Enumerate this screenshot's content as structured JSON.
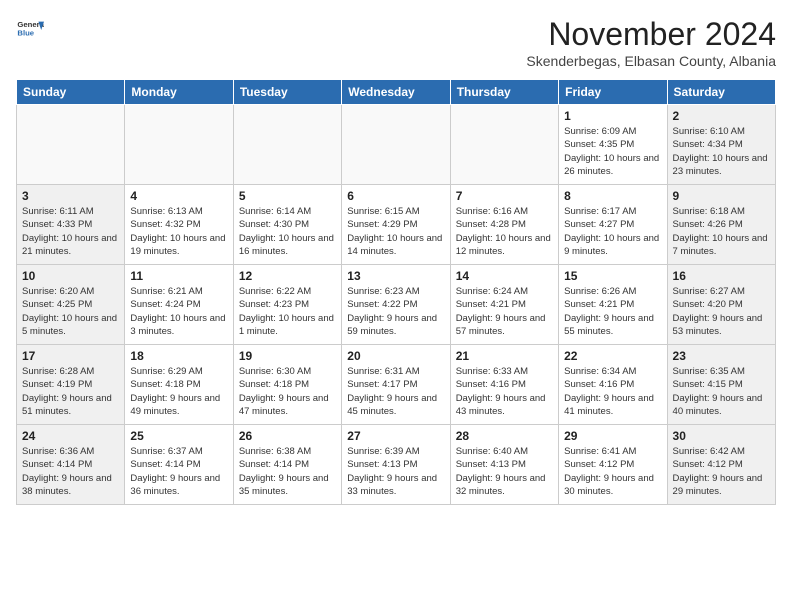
{
  "header": {
    "logo": {
      "general": "General",
      "blue": "Blue"
    },
    "month_year": "November 2024",
    "location": "Skenderbegas, Elbasan County, Albania"
  },
  "days_of_week": [
    "Sunday",
    "Monday",
    "Tuesday",
    "Wednesday",
    "Thursday",
    "Friday",
    "Saturday"
  ],
  "weeks": [
    [
      {
        "day": "",
        "info": ""
      },
      {
        "day": "",
        "info": ""
      },
      {
        "day": "",
        "info": ""
      },
      {
        "day": "",
        "info": ""
      },
      {
        "day": "",
        "info": ""
      },
      {
        "day": "1",
        "info": "Sunrise: 6:09 AM\nSunset: 4:35 PM\nDaylight: 10 hours and 26 minutes."
      },
      {
        "day": "2",
        "info": "Sunrise: 6:10 AM\nSunset: 4:34 PM\nDaylight: 10 hours and 23 minutes."
      }
    ],
    [
      {
        "day": "3",
        "info": "Sunrise: 6:11 AM\nSunset: 4:33 PM\nDaylight: 10 hours and 21 minutes."
      },
      {
        "day": "4",
        "info": "Sunrise: 6:13 AM\nSunset: 4:32 PM\nDaylight: 10 hours and 19 minutes."
      },
      {
        "day": "5",
        "info": "Sunrise: 6:14 AM\nSunset: 4:30 PM\nDaylight: 10 hours and 16 minutes."
      },
      {
        "day": "6",
        "info": "Sunrise: 6:15 AM\nSunset: 4:29 PM\nDaylight: 10 hours and 14 minutes."
      },
      {
        "day": "7",
        "info": "Sunrise: 6:16 AM\nSunset: 4:28 PM\nDaylight: 10 hours and 12 minutes."
      },
      {
        "day": "8",
        "info": "Sunrise: 6:17 AM\nSunset: 4:27 PM\nDaylight: 10 hours and 9 minutes."
      },
      {
        "day": "9",
        "info": "Sunrise: 6:18 AM\nSunset: 4:26 PM\nDaylight: 10 hours and 7 minutes."
      }
    ],
    [
      {
        "day": "10",
        "info": "Sunrise: 6:20 AM\nSunset: 4:25 PM\nDaylight: 10 hours and 5 minutes."
      },
      {
        "day": "11",
        "info": "Sunrise: 6:21 AM\nSunset: 4:24 PM\nDaylight: 10 hours and 3 minutes."
      },
      {
        "day": "12",
        "info": "Sunrise: 6:22 AM\nSunset: 4:23 PM\nDaylight: 10 hours and 1 minute."
      },
      {
        "day": "13",
        "info": "Sunrise: 6:23 AM\nSunset: 4:22 PM\nDaylight: 9 hours and 59 minutes."
      },
      {
        "day": "14",
        "info": "Sunrise: 6:24 AM\nSunset: 4:21 PM\nDaylight: 9 hours and 57 minutes."
      },
      {
        "day": "15",
        "info": "Sunrise: 6:26 AM\nSunset: 4:21 PM\nDaylight: 9 hours and 55 minutes."
      },
      {
        "day": "16",
        "info": "Sunrise: 6:27 AM\nSunset: 4:20 PM\nDaylight: 9 hours and 53 minutes."
      }
    ],
    [
      {
        "day": "17",
        "info": "Sunrise: 6:28 AM\nSunset: 4:19 PM\nDaylight: 9 hours and 51 minutes."
      },
      {
        "day": "18",
        "info": "Sunrise: 6:29 AM\nSunset: 4:18 PM\nDaylight: 9 hours and 49 minutes."
      },
      {
        "day": "19",
        "info": "Sunrise: 6:30 AM\nSunset: 4:18 PM\nDaylight: 9 hours and 47 minutes."
      },
      {
        "day": "20",
        "info": "Sunrise: 6:31 AM\nSunset: 4:17 PM\nDaylight: 9 hours and 45 minutes."
      },
      {
        "day": "21",
        "info": "Sunrise: 6:33 AM\nSunset: 4:16 PM\nDaylight: 9 hours and 43 minutes."
      },
      {
        "day": "22",
        "info": "Sunrise: 6:34 AM\nSunset: 4:16 PM\nDaylight: 9 hours and 41 minutes."
      },
      {
        "day": "23",
        "info": "Sunrise: 6:35 AM\nSunset: 4:15 PM\nDaylight: 9 hours and 40 minutes."
      }
    ],
    [
      {
        "day": "24",
        "info": "Sunrise: 6:36 AM\nSunset: 4:14 PM\nDaylight: 9 hours and 38 minutes."
      },
      {
        "day": "25",
        "info": "Sunrise: 6:37 AM\nSunset: 4:14 PM\nDaylight: 9 hours and 36 minutes."
      },
      {
        "day": "26",
        "info": "Sunrise: 6:38 AM\nSunset: 4:14 PM\nDaylight: 9 hours and 35 minutes."
      },
      {
        "day": "27",
        "info": "Sunrise: 6:39 AM\nSunset: 4:13 PM\nDaylight: 9 hours and 33 minutes."
      },
      {
        "day": "28",
        "info": "Sunrise: 6:40 AM\nSunset: 4:13 PM\nDaylight: 9 hours and 32 minutes."
      },
      {
        "day": "29",
        "info": "Sunrise: 6:41 AM\nSunset: 4:12 PM\nDaylight: 9 hours and 30 minutes."
      },
      {
        "day": "30",
        "info": "Sunrise: 6:42 AM\nSunset: 4:12 PM\nDaylight: 9 hours and 29 minutes."
      }
    ]
  ]
}
